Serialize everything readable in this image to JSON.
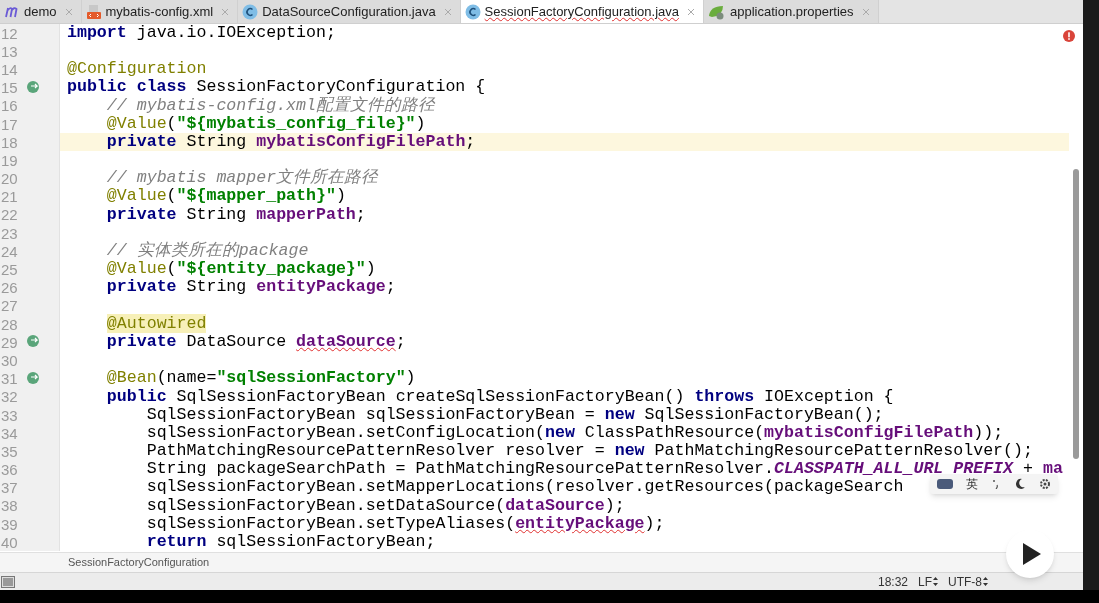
{
  "tabs": [
    {
      "label": "demo",
      "kind": "module",
      "selected": false,
      "underline": false
    },
    {
      "label": "mybatis-config.xml",
      "kind": "xml",
      "selected": false,
      "underline": false
    },
    {
      "label": "DataSourceConfiguration.java",
      "kind": "class",
      "selected": false,
      "underline": false
    },
    {
      "label": "SessionFactoryConfiguration.java",
      "kind": "class",
      "selected": true,
      "underline": true
    },
    {
      "label": "application.properties",
      "kind": "properties",
      "selected": false,
      "underline": false
    }
  ],
  "editor": {
    "lines": [
      {
        "number": "12",
        "current": false,
        "gutter_icon": false,
        "segments": [
          {
            "text": "import ",
            "kind": "keyword"
          },
          {
            "text": "java.io.IOException;",
            "kind": "plain"
          }
        ]
      },
      {
        "number": "13",
        "current": false,
        "gutter_icon": false
      },
      {
        "number": "14",
        "current": false,
        "gutter_icon": false,
        "segments": [
          {
            "text": "@Configuration",
            "kind": "annotation"
          }
        ]
      },
      {
        "number": "15",
        "current": false,
        "gutter_icon": true,
        "segments": [
          {
            "text": "public class ",
            "kind": "keyword"
          },
          {
            "text": "SessionFactoryConfiguration {",
            "kind": "plain"
          }
        ]
      },
      {
        "number": "16",
        "current": false,
        "gutter_icon": false,
        "segments": [
          {
            "text": "    // mybatis-config.xml配置文件的路径",
            "kind": "comment"
          }
        ]
      },
      {
        "number": "17",
        "current": false,
        "gutter_icon": false,
        "segments": [
          {
            "text": "    @Value",
            "kind": "annotation"
          },
          {
            "text": "(",
            "kind": "plain"
          },
          {
            "text": "\"${mybatis_config_file}\"",
            "kind": "string"
          },
          {
            "text": ")",
            "kind": "plain"
          }
        ]
      },
      {
        "number": "18",
        "current": true,
        "gutter_icon": false,
        "segments": [
          {
            "text": "    private ",
            "kind": "keyword"
          },
          {
            "text": "String ",
            "kind": "plain"
          },
          {
            "text": "mybatisConfigFilePath",
            "kind": "field"
          },
          {
            "text": ";",
            "kind": "plain"
          }
        ]
      },
      {
        "number": "19",
        "current": false,
        "gutter_icon": false
      },
      {
        "number": "20",
        "current": false,
        "gutter_icon": false,
        "segments": [
          {
            "text": "    // mybatis mapper文件所在路径",
            "kind": "comment"
          }
        ]
      },
      {
        "number": "21",
        "current": false,
        "gutter_icon": false,
        "segments": [
          {
            "text": "    @Value",
            "kind": "annotation"
          },
          {
            "text": "(",
            "kind": "plain"
          },
          {
            "text": "\"${mapper_path}\"",
            "kind": "string"
          },
          {
            "text": ")",
            "kind": "plain"
          }
        ]
      },
      {
        "number": "22",
        "current": false,
        "gutter_icon": false,
        "segments": [
          {
            "text": "    private ",
            "kind": "keyword"
          },
          {
            "text": "String ",
            "kind": "plain"
          },
          {
            "text": "mapperPath",
            "kind": "field"
          },
          {
            "text": ";",
            "kind": "plain"
          }
        ]
      },
      {
        "number": "23",
        "current": false,
        "gutter_icon": false
      },
      {
        "number": "24",
        "current": false,
        "gutter_icon": false,
        "segments": [
          {
            "text": "    // 实体类所在的package",
            "kind": "comment"
          }
        ]
      },
      {
        "number": "25",
        "current": false,
        "gutter_icon": false,
        "segments": [
          {
            "text": "    @Value",
            "kind": "annotation"
          },
          {
            "text": "(",
            "kind": "plain"
          },
          {
            "text": "\"${entity_package}\"",
            "kind": "string"
          },
          {
            "text": ")",
            "kind": "plain"
          }
        ]
      },
      {
        "number": "26",
        "current": false,
        "gutter_icon": false,
        "segments": [
          {
            "text": "    private ",
            "kind": "keyword"
          },
          {
            "text": "String ",
            "kind": "plain"
          },
          {
            "text": "entityPackage",
            "kind": "field"
          },
          {
            "text": ";",
            "kind": "plain"
          }
        ]
      },
      {
        "number": "27",
        "current": false,
        "gutter_icon": false
      },
      {
        "number": "28",
        "current": false,
        "gutter_icon": false,
        "segments": [
          {
            "text": "    @Autowired",
            "kind": "annotation",
            "highlighted": true
          }
        ]
      },
      {
        "number": "29",
        "current": false,
        "gutter_icon": true,
        "segments": [
          {
            "text": "    private ",
            "kind": "keyword"
          },
          {
            "text": "DataSource ",
            "kind": "plain"
          },
          {
            "text": "dataSource",
            "kind": "field",
            "squiggle": true
          },
          {
            "text": ";",
            "kind": "plain"
          }
        ]
      },
      {
        "number": "30",
        "current": false,
        "gutter_icon": false
      },
      {
        "number": "31",
        "current": false,
        "gutter_icon": true,
        "segments": [
          {
            "text": "    @Bean",
            "kind": "annotation"
          },
          {
            "text": "(name=",
            "kind": "plain"
          },
          {
            "text": "\"sqlSessionFactory\"",
            "kind": "string"
          },
          {
            "text": ")",
            "kind": "plain"
          }
        ]
      },
      {
        "number": "32",
        "current": false,
        "gutter_icon": false,
        "segments": [
          {
            "text": "    public ",
            "kind": "keyword"
          },
          {
            "text": "SqlSessionFactoryBean createSqlSessionFactoryBean() ",
            "kind": "plain"
          },
          {
            "text": "throws ",
            "kind": "keyword"
          },
          {
            "text": "IOException {",
            "kind": "plain"
          }
        ]
      },
      {
        "number": "33",
        "current": false,
        "gutter_icon": false,
        "segments": [
          {
            "text": "        SqlSessionFactoryBean sqlSessionFactoryBean = ",
            "kind": "plain"
          },
          {
            "text": "new ",
            "kind": "keyword"
          },
          {
            "text": "SqlSessionFactoryBean();",
            "kind": "plain"
          }
        ]
      },
      {
        "number": "34",
        "current": false,
        "gutter_icon": false,
        "segments": [
          {
            "text": "        sqlSessionFactoryBean.setConfigLocation(",
            "kind": "plain"
          },
          {
            "text": "new ",
            "kind": "keyword"
          },
          {
            "text": "ClassPathResource(",
            "kind": "plain"
          },
          {
            "text": "mybatisConfigFilePath",
            "kind": "field"
          },
          {
            "text": "));",
            "kind": "plain"
          }
        ]
      },
      {
        "number": "35",
        "current": false,
        "gutter_icon": false,
        "segments": [
          {
            "text": "        PathMatchingResourcePatternResolver resolver = ",
            "kind": "plain"
          },
          {
            "text": "new ",
            "kind": "keyword"
          },
          {
            "text": "PathMatchingResourcePatternResolver();",
            "kind": "plain"
          }
        ]
      },
      {
        "number": "36",
        "current": false,
        "gutter_icon": false,
        "segments": [
          {
            "text": "        String packageSearchPath = PathMatchingResourcePatternResolver.",
            "kind": "plain"
          },
          {
            "text": "CLASSPATH_ALL_URL_PREFIX",
            "kind": "constant"
          },
          {
            "text": " + ",
            "kind": "plain"
          },
          {
            "text": "ma",
            "kind": "field"
          }
        ]
      },
      {
        "number": "37",
        "current": false,
        "gutter_icon": false,
        "segments": [
          {
            "text": "        sqlSessionFactoryBean.setMapperLocations(resolver.getResources(packageSearch",
            "kind": "plain"
          }
        ]
      },
      {
        "number": "38",
        "current": false,
        "gutter_icon": false,
        "segments": [
          {
            "text": "        sqlSessionFactoryBean.setDataSource(",
            "kind": "plain"
          },
          {
            "text": "dataSource",
            "kind": "field"
          },
          {
            "text": ");",
            "kind": "plain"
          }
        ]
      },
      {
        "number": "39",
        "current": false,
        "gutter_icon": false,
        "segments": [
          {
            "text": "        sqlSessionFactoryBean.setTypeAliases(",
            "kind": "plain"
          },
          {
            "text": "entityPackage",
            "kind": "field",
            "squiggle": true
          },
          {
            "text": ");",
            "kind": "plain"
          }
        ]
      },
      {
        "number": "40",
        "current": false,
        "gutter_icon": false,
        "segments": [
          {
            "text": "        return ",
            "kind": "keyword"
          },
          {
            "text": "sqlSessionFactoryBean;",
            "kind": "plain"
          }
        ]
      }
    ]
  },
  "breadcrumb": "SessionFactoryConfiguration",
  "status_bar": {
    "position": "18:32",
    "line_separator": "LF",
    "encoding": "UTF-8"
  },
  "ime_toolbar": {
    "mode": "英"
  }
}
